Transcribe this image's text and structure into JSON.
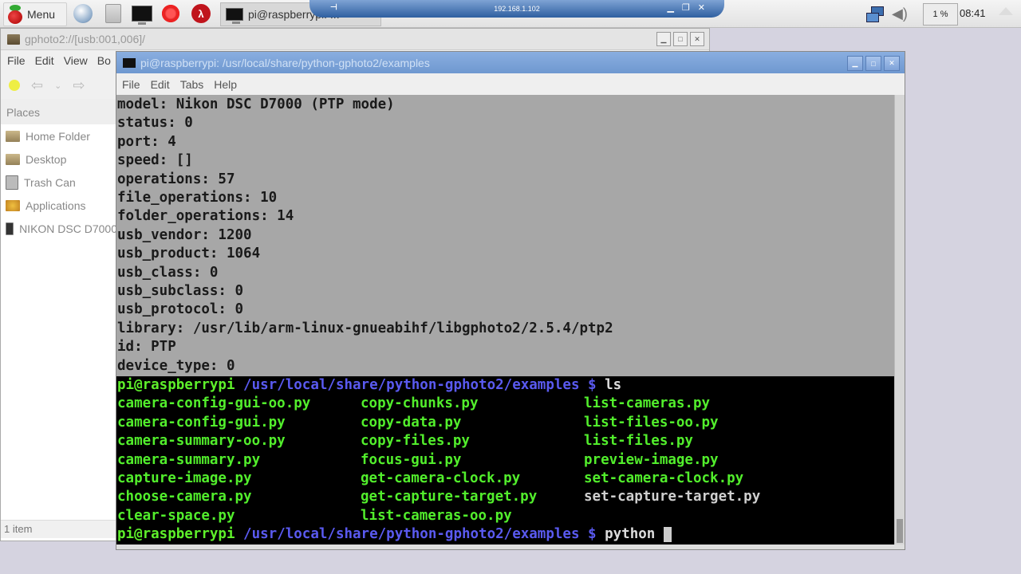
{
  "taskbar": {
    "menu_label": "Menu",
    "launchers": [
      "web-browser",
      "file-manager",
      "terminal",
      "wolfram",
      "mathematica"
    ],
    "task_terminal_label": "pi@raspberrypi: ...",
    "cpu_label": "1 %",
    "clock": "08:41"
  },
  "vnc": {
    "host": "192.168.1.102"
  },
  "file_manager": {
    "title": "gphoto2://[usb:001,006]/",
    "menu": [
      "File",
      "Edit",
      "View",
      "Bo"
    ],
    "places_header": "Places",
    "places": [
      {
        "label": "Home Folder",
        "icon": "folder-icon"
      },
      {
        "label": "Desktop",
        "icon": "folder-icon"
      },
      {
        "label": "Trash Can",
        "icon": "trash-icon"
      },
      {
        "label": "Applications",
        "icon": "applications-icon"
      },
      {
        "label": "NIKON DSC D7000",
        "icon": "camera-icon"
      }
    ],
    "status": "1 item"
  },
  "terminal": {
    "title": "pi@raspberrypi: /usr/local/share/python-gphoto2/examples",
    "menu": [
      "File",
      "Edit",
      "Tabs",
      "Help"
    ],
    "output_lines": [
      "model: Nikon DSC D7000 (PTP mode)",
      "status: 0",
      "port: 4",
      "speed: []",
      "operations: 57",
      "file_operations: 10",
      "folder_operations: 14",
      "usb_vendor: 1200",
      "usb_product: 1064",
      "usb_class: 0",
      "usb_subclass: 0",
      "usb_protocol: 0",
      "library: /usr/lib/arm-linux-gnueabihf/libgphoto2/2.5.4/ptp2",
      "id: PTP",
      "device_type: 0"
    ],
    "prompt_user": "pi@raspberrypi",
    "prompt_path": " /usr/local/share/python-gphoto2/examples $ ",
    "ls_command": "ls",
    "ls_rows": [
      [
        "camera-config-gui-oo.py",
        "copy-chunks.py",
        "list-cameras.py"
      ],
      [
        "camera-config-gui.py",
        "copy-data.py",
        "list-files-oo.py"
      ],
      [
        "camera-summary-oo.py",
        "copy-files.py",
        "list-files.py"
      ],
      [
        "camera-summary.py",
        "focus-gui.py",
        "preview-image.py"
      ],
      [
        "capture-image.py",
        "get-camera-clock.py",
        "set-camera-clock.py"
      ],
      [
        "choose-camera.py",
        "get-capture-target.py",
        "set-capture-target.py"
      ],
      [
        "clear-space.py",
        "list-cameras-oo.py",
        ""
      ]
    ],
    "current_input": "python "
  }
}
